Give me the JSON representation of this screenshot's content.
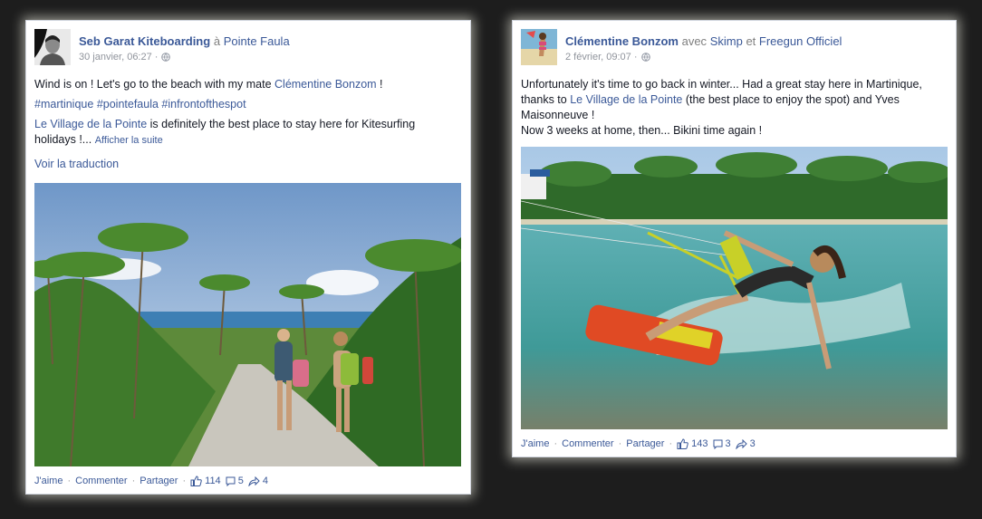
{
  "post1": {
    "author": "Seb Garat Kiteboarding",
    "preposition": "à",
    "place": "Pointe Faula",
    "date": "30 janvier, 06:27 ·",
    "line1_text": "Wind is on ! Let's go to the beach with my mate ",
    "line1_mention": "Clémentine Bonzom",
    "line1_end": " !",
    "hashtags": [
      "#martinique",
      "#pointefaula",
      "#infrontofthespot"
    ],
    "line3_link": "Le Village de la Pointe",
    "line3_text": " is definitely the best place to stay here for Kitesurfing",
    "line4_text": "holidays !...",
    "see_more": "Afficher la suite",
    "translate": "Voir la traduction",
    "actions": {
      "like": "J'aime",
      "comment": "Commenter",
      "share": "Partager",
      "sep": "·"
    },
    "stats": {
      "likes": "114",
      "comments": "5",
      "shares": "4"
    }
  },
  "post2": {
    "author": "Clémentine Bonzom",
    "with_word": "avec",
    "tag1": "Skimp",
    "and_word": "et",
    "tag2": "Freegun Officiel",
    "date": "2 février, 09:07 ·",
    "line1": "Unfortunately it's time to go back in winter... Had a great stay here in Martinique,",
    "line2_start": "thanks to ",
    "line2_link": "Le Village de la Pointe",
    "line2_end": " (the best place to enjoy the spot) and Yves",
    "line3": "Maisonneuve !",
    "line4": "Now 3 weeks at home, then... Bikini time again !",
    "actions": {
      "like": "J'aime",
      "comment": "Commenter",
      "share": "Partager",
      "sep": "·"
    },
    "stats": {
      "likes": "143",
      "comments": "3",
      "shares": "3"
    }
  },
  "colors": {
    "link": "#3b5998",
    "background": "#1d1d1d",
    "glow": "#fffff0"
  },
  "icons": [
    "globe-icon",
    "like-icon",
    "comment-icon",
    "share-icon"
  ]
}
